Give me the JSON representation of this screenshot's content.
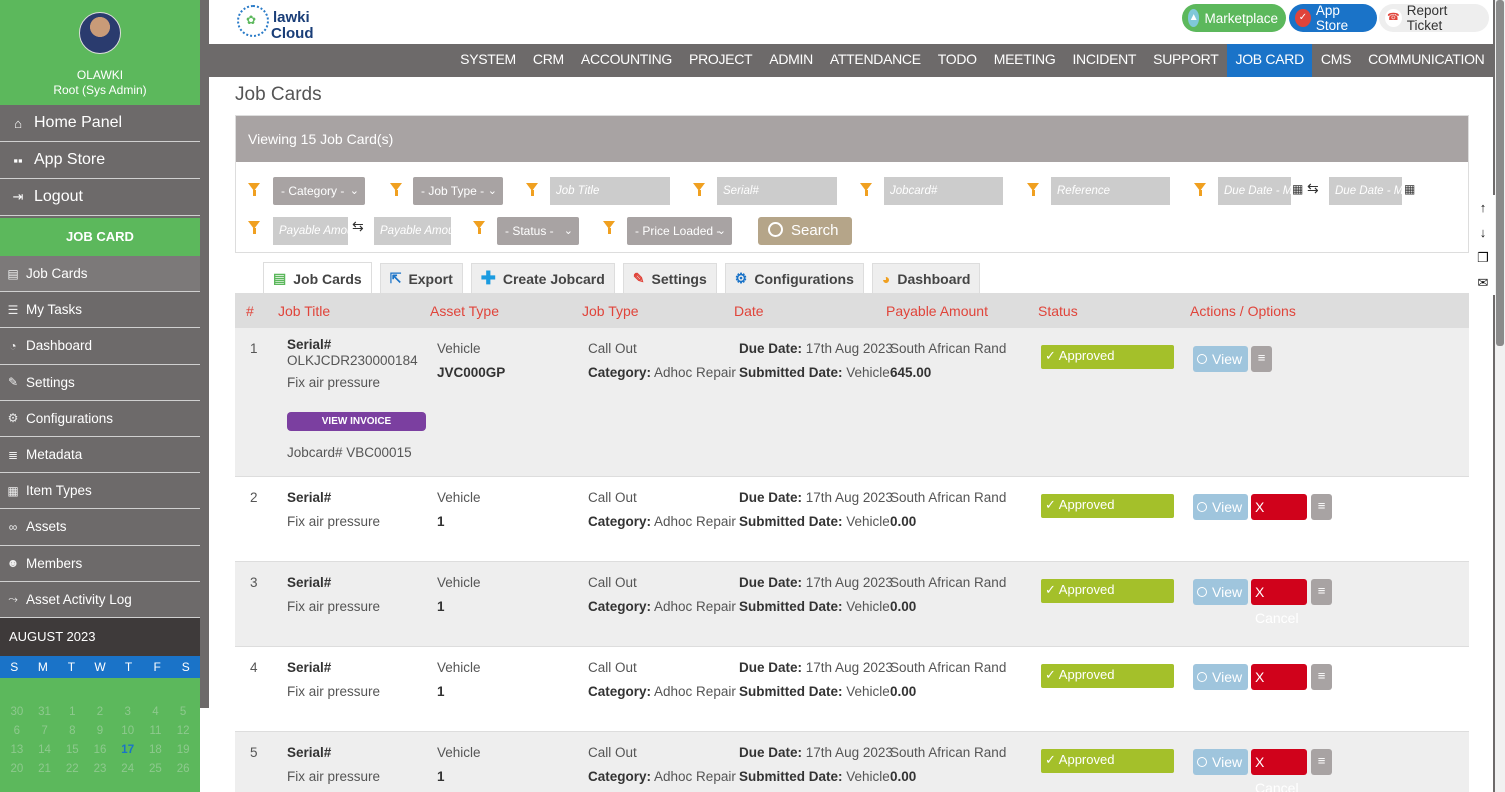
{
  "user": {
    "name": "OLAWKI",
    "role": "Root (Sys Admin)"
  },
  "sidebar": {
    "main_items": [
      {
        "label": "Home Panel",
        "icon": "home-icon"
      },
      {
        "label": "App Store",
        "icon": "apps-icon"
      },
      {
        "label": "Logout",
        "icon": "logout-icon"
      }
    ],
    "section_title": "JOB CARD",
    "sub_items": [
      {
        "label": "Job Cards",
        "icon": "id-card-icon"
      },
      {
        "label": "My Tasks",
        "icon": "tasks-icon"
      },
      {
        "label": "Dashboard",
        "icon": "pie-chart-icon"
      },
      {
        "label": "Settings",
        "icon": "settings-icon"
      },
      {
        "label": "Configurations",
        "icon": "gears-icon"
      },
      {
        "label": "Metadata",
        "icon": "list-icon"
      },
      {
        "label": "Item Types",
        "icon": "item-types-icon"
      },
      {
        "label": "Assets",
        "icon": "assets-icon"
      },
      {
        "label": "Members",
        "icon": "members-icon"
      },
      {
        "label": "Asset Activity Log",
        "icon": "activity-icon"
      }
    ]
  },
  "calendar": {
    "month": "AUGUST 2023",
    "day_headers": [
      "S",
      "M",
      "T",
      "W",
      "T",
      "F",
      "S"
    ],
    "days": [
      "30",
      "31",
      "1",
      "2",
      "3",
      "4",
      "5",
      "6",
      "7",
      "8",
      "9",
      "10",
      "11",
      "12",
      "13",
      "14",
      "15",
      "16",
      "17",
      "18",
      "19",
      "20",
      "21",
      "22",
      "23",
      "24",
      "25",
      "26"
    ],
    "today": "17"
  },
  "header": {
    "logo_line1": "lawki",
    "logo_line2": "Cloud",
    "marketplace": "Marketplace",
    "app_store": "App Store",
    "report_ticket": "Report Ticket"
  },
  "menu": [
    "SYSTEM",
    "CRM",
    "ACCOUNTING",
    "PROJECT",
    "ADMIN",
    "ATTENDANCE",
    "TODO",
    "MEETING",
    "INCIDENT",
    "SUPPORT",
    "JOB CARD",
    "CMS",
    "COMMUNICATION"
  ],
  "menu_active": "JOB CARD",
  "page": {
    "title": "Job Cards",
    "viewing": "Viewing 15 Job Card(s)"
  },
  "filters": {
    "category": "- Category -",
    "job_type": "- Job Type -",
    "job_title": "Job Title",
    "serial": "Serial#",
    "jobcard": "Jobcard#",
    "reference": "Reference",
    "due_date_min": "Due Date - Mi",
    "due_date_max": "Due Date - M",
    "payable_min": "Payable Amou",
    "payable_max": "Payable Amou",
    "status": "- Status -",
    "price_loaded": "- Price Loaded -",
    "search": "Search"
  },
  "tabs": [
    {
      "label": "Job Cards",
      "icon": "id-card-icon"
    },
    {
      "label": "Export",
      "icon": "export-icon"
    },
    {
      "label": "Create Jobcard",
      "icon": "plus-icon"
    },
    {
      "label": "Settings",
      "icon": "settings-icon"
    },
    {
      "label": "Configurations",
      "icon": "gears-icon"
    },
    {
      "label": "Dashboard",
      "icon": "pie-chart-icon"
    }
  ],
  "table": {
    "headers": [
      "#",
      "Job Title",
      "Asset Type",
      "Job Type",
      "Date",
      "Payable Amount",
      "Status",
      "Actions / Options"
    ],
    "rows": [
      {
        "num": "1",
        "serial_label": "Serial#",
        "serial_value": "OLKJCDR230000184",
        "title": "Fix air pressure",
        "invoice": "VIEW INVOICE",
        "jobcard": "Jobcard# VBC00015",
        "asset_type": "Vehicle",
        "asset": "JVC000GP",
        "job_type": "Call Out",
        "category_label": "Category:",
        "category": "Adhoc Repair",
        "due_label": "Due Date:",
        "due": "17th Aug 2023",
        "submitted_label": "Submitted Date:",
        "submitted": "Vehicle",
        "currency": "South African Rand",
        "amount": "645.00",
        "status": "✓ Approved",
        "view": "View",
        "cancel": ""
      },
      {
        "num": "2",
        "serial_label": "Serial#",
        "title": "Fix air pressure",
        "asset_type": "Vehicle",
        "asset": "1",
        "job_type": "Call Out",
        "category_label": "Category:",
        "category": "Adhoc Repair",
        "due_label": "Due Date:",
        "due": "17th Aug 2023",
        "submitted_label": "Submitted Date:",
        "submitted": "Vehicle",
        "currency": "South African Rand",
        "amount": "0.00",
        "status": "✓ Approved",
        "view": "View",
        "cancel": "X Cancel"
      },
      {
        "num": "3",
        "serial_label": "Serial#",
        "title": "Fix air pressure",
        "asset_type": "Vehicle",
        "asset": "1",
        "job_type": "Call Out",
        "category_label": "Category:",
        "category": "Adhoc Repair",
        "due_label": "Due Date:",
        "due": "17th Aug 2023",
        "submitted_label": "Submitted Date:",
        "submitted": "Vehicle",
        "currency": "South African Rand",
        "amount": "0.00",
        "status": "✓ Approved",
        "view": "View",
        "cancel": "X Cancel"
      },
      {
        "num": "4",
        "serial_label": "Serial#",
        "title": "Fix air pressure",
        "asset_type": "Vehicle",
        "asset": "1",
        "job_type": "Call Out",
        "category_label": "Category:",
        "category": "Adhoc Repair",
        "due_label": "Due Date:",
        "due": "17th Aug 2023",
        "submitted_label": "Submitted Date:",
        "submitted": "Vehicle",
        "currency": "South African Rand",
        "amount": "0.00",
        "status": "✓ Approved",
        "view": "View",
        "cancel": "X Cancel"
      },
      {
        "num": "5",
        "serial_label": "Serial#",
        "title": "Fix air pressure",
        "asset_type": "Vehicle",
        "asset": "1",
        "job_type": "Call Out",
        "category_label": "Category:",
        "category": "Adhoc Repair",
        "due_label": "Due Date:",
        "due": "17th Aug 2023",
        "submitted_label": "Submitted Date:",
        "submitted": "Vehicle",
        "currency": "South African Rand",
        "amount": "0.00",
        "status": "✓ Approved",
        "view": "View",
        "cancel": "X Cancel"
      }
    ]
  },
  "colors": {
    "green": "#5cb85c",
    "blue": "#1a73c8",
    "gray": "#6d6a6a",
    "approved": "#a4c02a",
    "cancel": "#d0021b",
    "header_red": "#e0443a"
  }
}
